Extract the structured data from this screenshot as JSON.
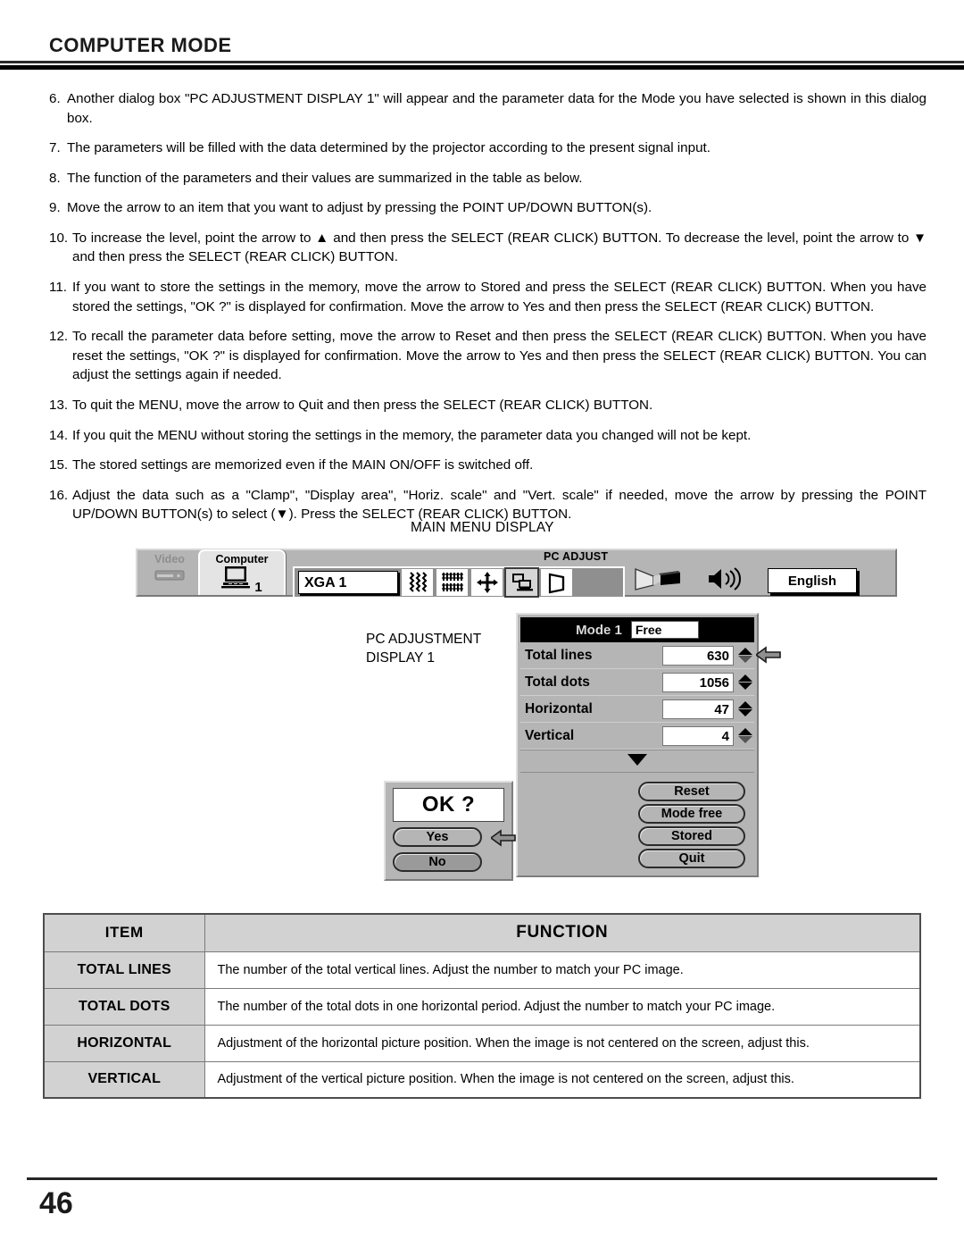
{
  "header": {
    "title": "COMPUTER MODE"
  },
  "steps": [
    {
      "num": "6.",
      "text": "Another dialog box \"PC ADJUSTMENT DISPLAY 1\" will appear and the parameter data for the Mode you have selected is shown in this dialog box."
    },
    {
      "num": "7.",
      "text": "The parameters will be filled with the data determined by the projector according to the present signal input."
    },
    {
      "num": "8.",
      "text": "The function of the parameters and their values are summarized in the table as below."
    },
    {
      "num": "9.",
      "text": "Move the arrow to an item that you want to adjust by pressing the POINT UP/DOWN BUTTON(s)."
    },
    {
      "num": "10.",
      "text": "To increase the level, point the arrow to ▲ and then press the SELECT (REAR CLICK) BUTTON. To decrease the level, point the arrow to ▼ and then press the SELECT (REAR CLICK) BUTTON."
    },
    {
      "num": "11.",
      "text": "If you want to store the settings in the memory, move the arrow to Stored and press the SELECT (REAR CLICK) BUTTON. When you have stored the settings, \"OK ?\" is displayed for confirmation.  Move the arrow to Yes and then press the SELECT (REAR CLICK) BUTTON."
    },
    {
      "num": "12.",
      "text": "To recall the parameter data before setting, move the arrow to Reset and then press the SELECT (REAR CLICK) BUTTON. When you have reset the settings, \"OK ?\" is displayed for confirmation. Move the arrow to Yes and then press the SELECT (REAR CLICK) BUTTON. You can adjust the settings again if needed."
    },
    {
      "num": "13.",
      "text": "To quit the MENU, move the arrow to Quit and then press the SELECT (REAR CLICK) BUTTON."
    },
    {
      "num": "14.",
      "text": "If you quit the MENU without storing the settings in the memory, the parameter data you changed will not be kept."
    },
    {
      "num": "15.",
      "text": "The stored settings are memorized even if the MAIN ON/OFF is switched off."
    },
    {
      "num": "16.",
      "text": "Adjust the data such as a \"Clamp\", \"Display area\", \"Horiz. scale\" and \"Vert. scale\" if needed, move the arrow by pressing the POINT UP/DOWN BUTTON(s) to select (▼). Press the SELECT (REAR CLICK) BUTTON."
    }
  ],
  "figure": {
    "main_menu_caption": "MAIN MENU DISPLAY",
    "pcadj_caption_line1": "PC ADJUSTMENT",
    "pcadj_caption_line2": "DISPLAY 1",
    "osd": {
      "video_tab_label": "Video",
      "computer_tab_label": "Computer",
      "computer_tab_number": "1",
      "pc_adjust_label": "PC ADJUST",
      "mode_value": "XGA 1",
      "language_value": "English",
      "icons": [
        "fine-sync-icon",
        "total-dots-icon",
        "picture-position-icon",
        "pc-adjust-icon",
        "screen-icon"
      ],
      "right_icons": [
        "projector-image-icon",
        "sound-volume-icon"
      ]
    },
    "pcadj_panel": {
      "mode_title": "Mode 1",
      "mode_state": "Free",
      "params": [
        {
          "label": "Total lines",
          "value": "630"
        },
        {
          "label": "Total dots",
          "value": "1056"
        },
        {
          "label": "Horizontal",
          "value": "47"
        },
        {
          "label": "Vertical",
          "value": "4"
        }
      ],
      "buttons": [
        "Reset",
        "Mode free",
        "Stored",
        "Quit"
      ]
    },
    "ok_dialog": {
      "title": "OK ?",
      "yes_label": "Yes",
      "no_label": "No"
    }
  },
  "table": {
    "headers": [
      "ITEM",
      "FUNCTION"
    ],
    "rows": [
      {
        "item": "TOTAL LINES",
        "function": "The number of the total vertical lines. Adjust the number to match your PC image."
      },
      {
        "item": "TOTAL DOTS",
        "function": "The number of the total dots in one horizontal period. Adjust the number to match your PC image."
      },
      {
        "item": "HORIZONTAL",
        "function": "Adjustment of the horizontal picture position. When the image is not centered on the screen, adjust this."
      },
      {
        "item": "VERTICAL",
        "function": "Adjustment of the vertical picture position. When the image is not centered on the screen, adjust this."
      }
    ]
  },
  "footer": {
    "page_number": "46"
  },
  "colors": {
    "osd_gray": "#b5b5b5",
    "osd_dark": "#8f8f8f",
    "header_black": "#000000",
    "table_header_gray": "#d2d2d2"
  }
}
